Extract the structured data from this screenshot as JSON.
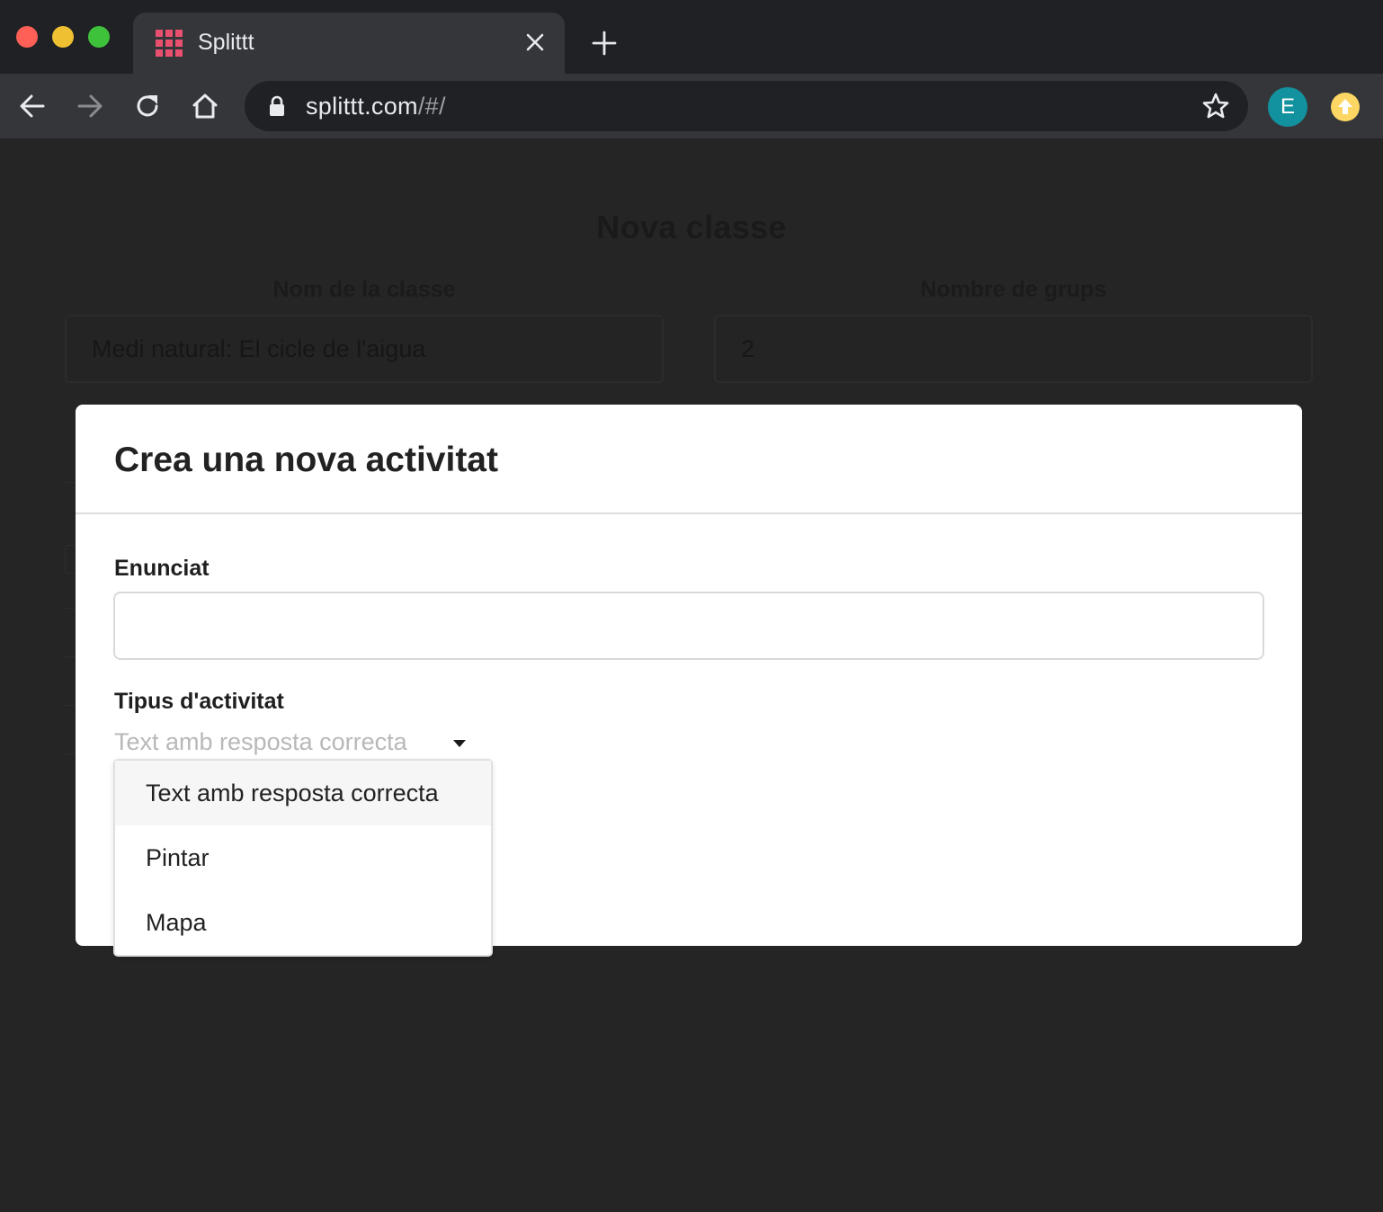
{
  "browser": {
    "tab": {
      "title": "Splittt",
      "favicon": "grid-favicon",
      "favicon_color": "#e8506e"
    },
    "address_bar": {
      "url_host": "splittt.com",
      "url_path": "/#/"
    },
    "profile_initial": "E",
    "profile_color": "#12919e",
    "update_color": "#fdd663"
  },
  "page": {
    "title": "Nova classe",
    "class_name_label": "Nom de la classe",
    "class_name_value": "Medi natural: El cicle de l'aigua",
    "groups_label": "Nombre de grups",
    "groups_value": "2"
  },
  "modal": {
    "title": "Crea una nova activitat",
    "statement_label": "Enunciat",
    "statement_value": "",
    "type_label": "Tipus d'activitat",
    "type_selected": "Text amb resposta correcta",
    "type_options": [
      "Text amb resposta correcta",
      "Pintar",
      "Mapa"
    ]
  }
}
